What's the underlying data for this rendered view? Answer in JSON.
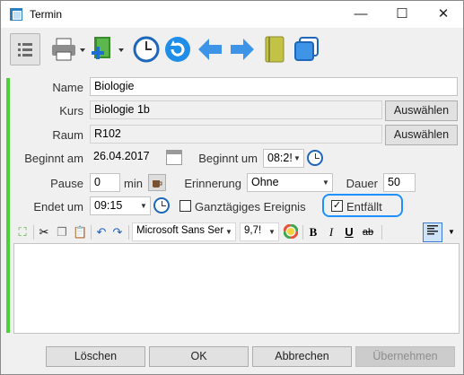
{
  "window": {
    "title": "Termin",
    "minimize": "—",
    "maximize": "☐",
    "close": "✕"
  },
  "form": {
    "name_label": "Name",
    "name_value": "Biologie",
    "kurs_label": "Kurs",
    "kurs_value": "Biologie 1b",
    "kurs_button": "Auswählen",
    "raum_label": "Raum",
    "raum_value": "R102",
    "raum_button": "Auswählen",
    "beginnt_am_label": "Beginnt am",
    "beginnt_am_value": "26.04.2017",
    "beginnt_um_label": "Beginnt um",
    "beginnt_um_value": "08:2!",
    "pause_label": "Pause",
    "pause_value": "0",
    "pause_unit": "min",
    "erinnerung_label": "Erinnerung",
    "erinnerung_value": "Ohne",
    "dauer_label": "Dauer",
    "dauer_value": "50",
    "endet_um_label": "Endet um",
    "endet_um_value": "09:15",
    "ganztaegig_label": "Ganztägiges Ereignis",
    "entfaellt_label": "Entfällt"
  },
  "format": {
    "font_name": "Microsoft Sans Ser",
    "font_size": "9,7!"
  },
  "footer": {
    "loeschen": "Löschen",
    "ok": "OK",
    "abbrechen": "Abbrechen",
    "uebernehmen": "Übernehmen"
  },
  "colors": {
    "accent": "#4cd137",
    "focus_ring": "#1e90ff"
  }
}
